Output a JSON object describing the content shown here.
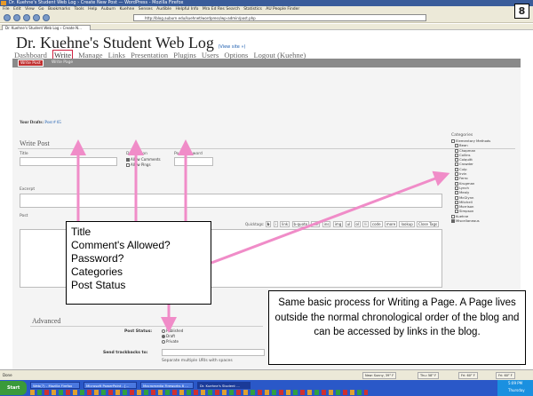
{
  "browser": {
    "window_title": "Dr. Kuehne's Student Web Log › Create New Post — WordPress - Mozilla Firefox",
    "menu": [
      "File",
      "Edit",
      "View",
      "Go",
      "Bookmarks",
      "Tools",
      "Help",
      "Auburn",
      "Kuehne",
      "Senses",
      "Audible",
      "Helpful Info",
      "Mra Ed Res Search",
      "Statistics",
      "AU People Finder"
    ],
    "url": "http://blog.auburn.edu/kuehnet/wordpress/wp-admin/post.php",
    "tab_label": "Dr. Kuehne's Student Web Log › Create N...",
    "status_text": "Done",
    "status_weather": [
      "New: Sunny, 39° F",
      "Thu: 58° F",
      "Fri: 60° F",
      "Fri: 60° F"
    ]
  },
  "slide": {
    "page_number": "8"
  },
  "wp": {
    "blog_title": "Dr. Kuehne's Student Web Log",
    "view_site": "(View site »)",
    "nav": [
      "Dashboard",
      "Write",
      "Manage",
      "Links",
      "Presentation",
      "Plugins",
      "Users",
      "Options",
      "Logout (Kuehne)"
    ],
    "active_nav": "Write",
    "subnav": [
      "Write Post",
      "Write Page"
    ],
    "drafts_label": "Your Drafts:",
    "drafts_link": "Post # 65",
    "write_post": {
      "heading": "Write Post",
      "title_label": "Title",
      "discussion_label": "Discussion",
      "allow_comments": "Allow Comments",
      "allow_pings": "Allow Pings",
      "password_label": "Post Password",
      "excerpt_label": "Excerpt",
      "post_label": "Post",
      "quicktags": [
        "b",
        "i",
        "link",
        "b-quote",
        "del",
        "ins",
        "img",
        "ul",
        "ol",
        "li",
        "code",
        "more",
        "lookup",
        "Close Tags"
      ],
      "quicktags_label": "Quicktags:"
    },
    "categories": {
      "heading": "Categories",
      "items": [
        "Elementary Methods",
        "Bean",
        "Chapman",
        "Collins",
        "Colquitt",
        "Crowder",
        "Culp",
        "Irvin",
        "Ferro",
        "Krugman",
        "Lynch",
        "Mealy",
        "McGlynn",
        "Mitchell",
        "Morrison",
        "Simpson",
        "Kuehne",
        "Miscellaneous"
      ],
      "checked": [
        "Miscellaneous"
      ]
    },
    "advanced": {
      "heading": "Advanced",
      "post_status_label": "Post Status:",
      "statuses": [
        "Published",
        "Draft",
        "Private"
      ],
      "selected_status": "Draft",
      "trackback_label": "Send trackbacks to:",
      "trackback_hint": "Separate multiple URIs with spaces"
    }
  },
  "annotation": {
    "lines": [
      "Title",
      "Comment's Allowed?",
      "Password?",
      "Categories",
      "Post Status"
    ],
    "note": "Same basic process for Writing a Page. A Page lives outside the normal chronological order of the blog and can be accessed by links in the blog.",
    "arrow_color": "#f08cc8"
  },
  "taskbar": {
    "start": "Start",
    "items": [
      "Web(7) - Mozilla Firefox",
      "Microsoft PowerPoint - [...",
      "Macromedia Fireworks 8 ...",
      "Dr. Kuehne's Student ..."
    ],
    "clock": "5:09 PM",
    "day": "Thursday"
  }
}
